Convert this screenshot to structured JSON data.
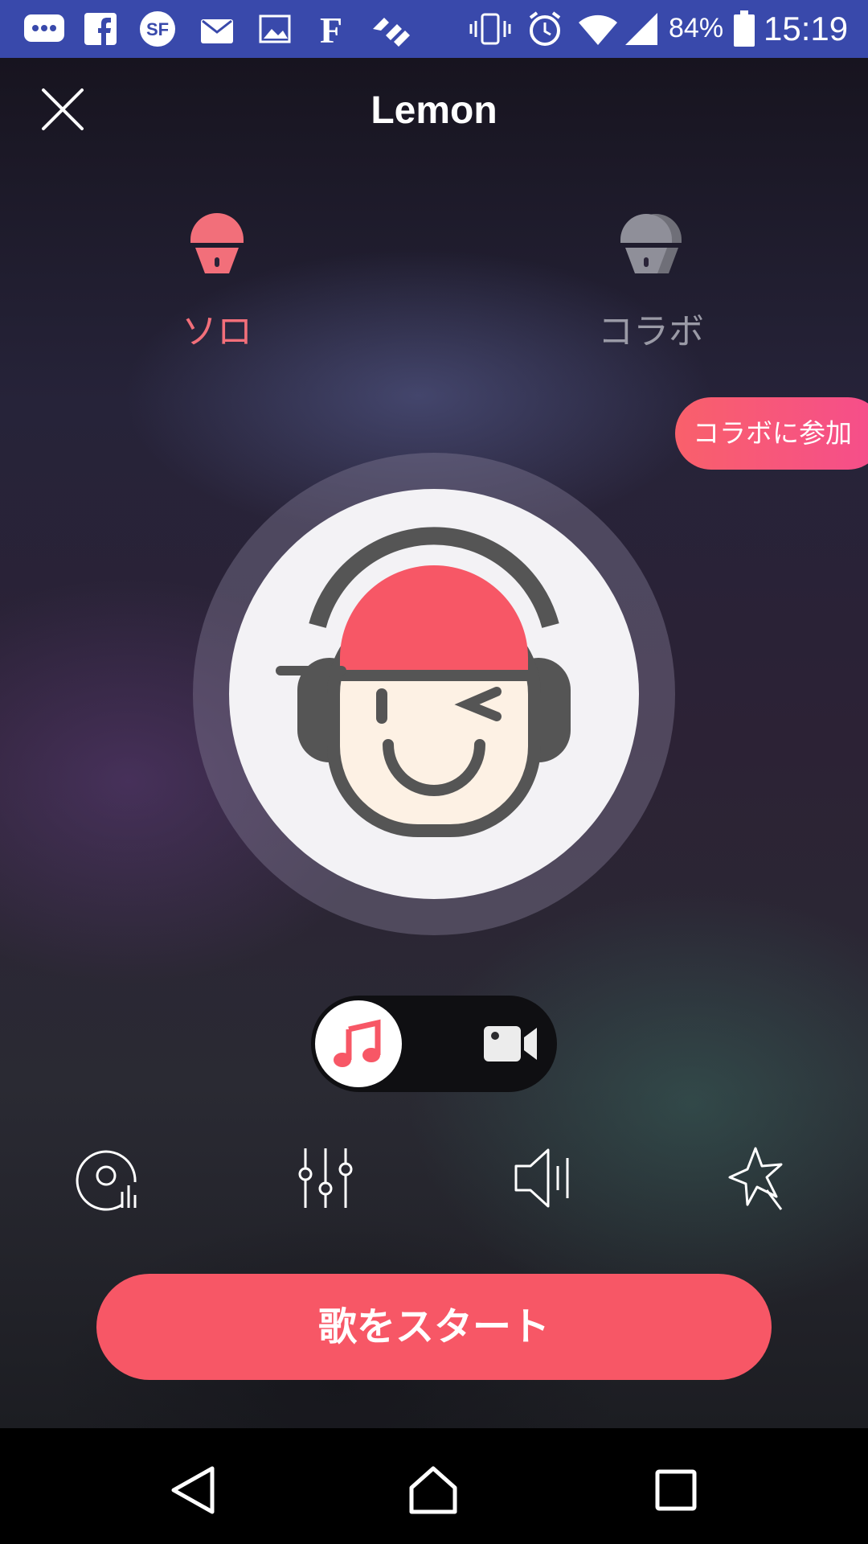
{
  "status_bar": {
    "icons": [
      "chat-icon",
      "facebook-icon",
      "sf-icon",
      "mail-icon",
      "image-icon",
      "f-icon",
      "app-icon",
      "vibrate-icon",
      "alarm-icon",
      "wifi-icon",
      "signal-icon",
      "battery-icon"
    ],
    "battery": "84%",
    "time": "15:19"
  },
  "header": {
    "title": "Lemon",
    "close_icon": "close-icon"
  },
  "modes": {
    "solo": {
      "label": "ソロ",
      "icon": "mic-icon",
      "color": "#f26f7a",
      "selected": true
    },
    "collab": {
      "label": "コラボ",
      "icon": "duo-mic-icon",
      "color": "#9a9aa6",
      "selected": false
    }
  },
  "join_collab": {
    "label": "コラボに参加"
  },
  "avatar": {
    "icon": "singer-avatar-icon"
  },
  "media_toggle": {
    "selected": "audio",
    "options": [
      "music-note-icon",
      "video-camera-icon"
    ]
  },
  "tools": [
    {
      "name": "vinyl-levels-icon"
    },
    {
      "name": "equalizer-icon"
    },
    {
      "name": "speaker-volume-icon"
    },
    {
      "name": "magic-star-icon"
    }
  ],
  "start_button": {
    "label": "歌をスタート"
  },
  "colors": {
    "accent": "#f75766",
    "status_bar": "#3949ab",
    "nav_bar": "#000000"
  },
  "nav_bar": {
    "icons": [
      "back-icon",
      "home-icon",
      "recents-icon"
    ]
  }
}
